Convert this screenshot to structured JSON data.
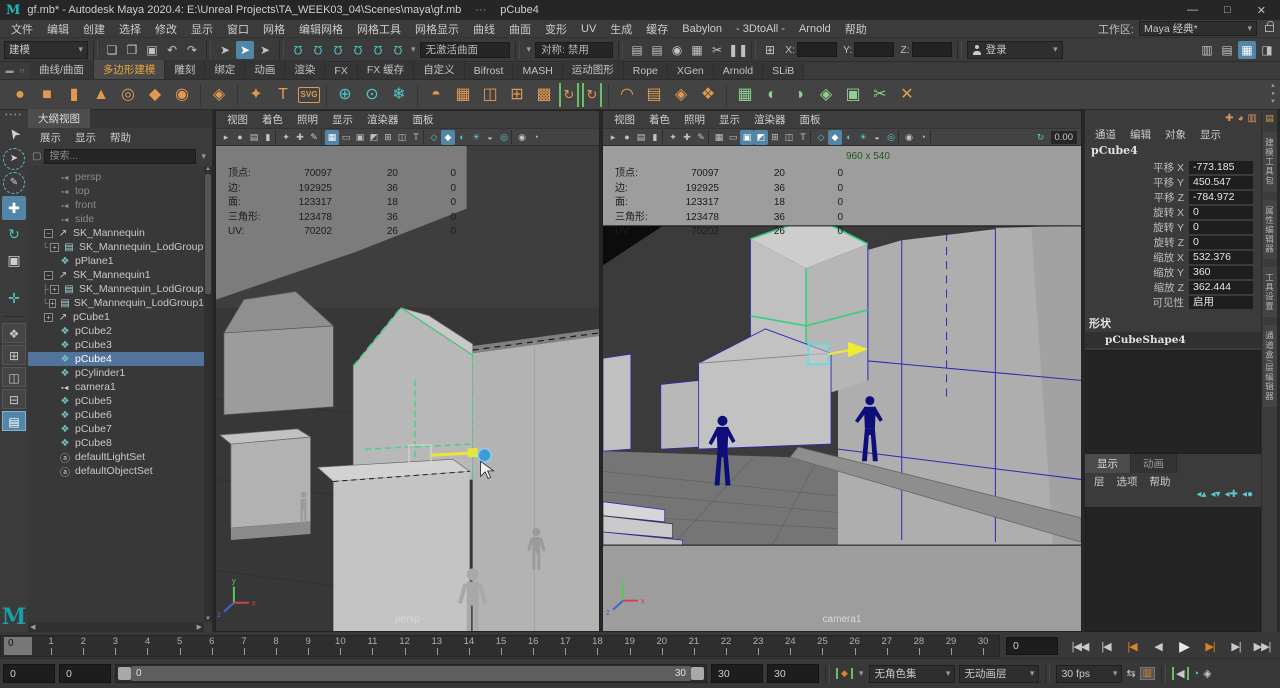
{
  "window": {
    "icon": "M",
    "title": "gf.mb* - Autodesk Maya 2020.4: E:\\Unreal Projects\\TA_WEEK03_04\\Scenes\\maya\\gf.mb",
    "dots": "···",
    "object": "pCube4",
    "minimize": "—",
    "maximize": "□",
    "close": "✕"
  },
  "menubar": {
    "items": [
      "文件",
      "编辑",
      "创建",
      "选择",
      "修改",
      "显示",
      "窗口",
      "网格",
      "编辑网格",
      "网格工具",
      "网格显示",
      "曲线",
      "曲面",
      "变形",
      "UV",
      "生成",
      "缓存",
      "Babylon",
      "- 3DtoAll -",
      "Arnold",
      "帮助"
    ],
    "workspace_label": "工作区:",
    "workspace_value": "Maya 经典*"
  },
  "statusline": {
    "mode": "建模",
    "file_icons": [
      {
        "n": "new-scene-icon",
        "g": "❏"
      },
      {
        "n": "open-scene-icon",
        "g": "❒"
      },
      {
        "n": "save-scene-icon",
        "g": "▣"
      },
      {
        "n": "undo-icon",
        "g": "↶"
      },
      {
        "n": "redo-icon",
        "g": "↷"
      }
    ],
    "select_icons": [
      {
        "n": "select-hierarchy-icon",
        "g": "➤"
      },
      {
        "n": "select-object-icon",
        "g": "➤",
        "a": true
      },
      {
        "n": "select-component-icon",
        "g": "➤"
      }
    ],
    "snap_icons": [
      {
        "n": "snap-to-grid-icon",
        "g": "Ω"
      },
      {
        "n": "snap-to-curve-icon",
        "g": "Ω"
      },
      {
        "n": "snap-to-point-icon",
        "g": "Ω"
      },
      {
        "n": "snap-to-projected-center-icon",
        "g": "Ω"
      },
      {
        "n": "snap-to-view-plane-icon",
        "g": "Ω"
      },
      {
        "n": "make-live-icon",
        "g": "Ω"
      }
    ],
    "no_active_surface": "无激活曲面",
    "symmetry": "对称: 禁用",
    "render_icons": [
      {
        "n": "render-view-icon",
        "g": "▤"
      },
      {
        "n": "render-current-frame-icon",
        "g": "▤"
      },
      {
        "n": "ipr-render-icon",
        "g": "◉",
        "t": true
      },
      {
        "n": "render-settings-icon",
        "g": "▦"
      },
      {
        "n": "render-sequence-icon",
        "g": "✂",
        "t": true
      },
      {
        "n": "pause-icon",
        "g": "❚❚"
      }
    ],
    "grid_toggle_glyph": "⊞",
    "x_label": "X:",
    "y_label": "Y:",
    "z_label": "Z:",
    "login_label": "登录",
    "right_icons": [
      {
        "n": "attribute-editor-toggle-icon",
        "g": "▥"
      },
      {
        "n": "tool-settings-toggle-icon",
        "g": "▤"
      },
      {
        "n": "channel-box-toggle-icon",
        "g": "▦",
        "a": true
      },
      {
        "n": "workspace-panel-icon",
        "g": "◨"
      }
    ]
  },
  "shelf": {
    "left_icons": [
      {
        "n": "shelf-tab-menu-icon",
        "g": "▬"
      },
      {
        "n": "shelf-menu-icon",
        "g": "○"
      }
    ],
    "tabs": [
      {
        "label": "曲线/曲面"
      },
      {
        "label": "多边形建模",
        "active": true
      },
      {
        "label": "雕刻"
      },
      {
        "label": "绑定"
      },
      {
        "label": "动画"
      },
      {
        "label": "渲染"
      },
      {
        "label": "FX"
      },
      {
        "label": "FX 缓存"
      },
      {
        "label": "自定义"
      },
      {
        "label": "Bifrost"
      },
      {
        "label": "MASH"
      },
      {
        "label": "运动图形"
      },
      {
        "label": "Rope"
      },
      {
        "label": "XGen"
      },
      {
        "label": "Arnold"
      },
      {
        "label": "SLiB"
      }
    ],
    "icons": [
      {
        "n": "poly-sphere-icon",
        "g": "●"
      },
      {
        "n": "poly-cube-icon",
        "g": "■"
      },
      {
        "n": "poly-cylinder-icon",
        "g": "▮"
      },
      {
        "n": "poly-cone-icon",
        "g": "▲"
      },
      {
        "n": "poly-torus-icon",
        "g": "◎"
      },
      {
        "n": "poly-plane-icon",
        "g": "◆"
      },
      {
        "n": "poly-disc-icon",
        "g": "◉"
      },
      {
        "sep": true
      },
      {
        "n": "platonic-solid-icon",
        "g": "◈"
      },
      {
        "sep": true
      },
      {
        "n": "curve-tool-icon",
        "g": "✦"
      },
      {
        "n": "type-tool-icon",
        "g": "T"
      },
      {
        "n": "svg-tool-icon",
        "g": "SVG",
        "sm": true
      },
      {
        "sep": true
      },
      {
        "n": "construction-plane-icon",
        "g": "⊕",
        "t": true
      },
      {
        "n": "time-node-icon",
        "g": "⊙",
        "t": true
      },
      {
        "n": "snap-origin-icon",
        "g": "❄",
        "t": true
      },
      {
        "sep": true
      },
      {
        "n": "boolean-icon",
        "g": "◓"
      },
      {
        "n": "combine-icon",
        "g": "▦"
      },
      {
        "n": "separate-icon",
        "g": "◫"
      },
      {
        "n": "smooth-icon",
        "g": "⊞"
      },
      {
        "n": "subdivide-icon",
        "g": "▩"
      },
      {
        "n": "quick-rig-icon",
        "g": "↻",
        "b": true
      },
      {
        "n": "auto-rig-icon",
        "g": "↻",
        "b": true
      },
      {
        "sep": true
      },
      {
        "n": "bend-deformer-icon",
        "g": "◠"
      },
      {
        "n": "lattice-icon",
        "g": "▤"
      },
      {
        "n": "wrap-deformer-icon",
        "g": "◈"
      },
      {
        "n": "cluster-icon",
        "g": "❖"
      },
      {
        "sep": true
      },
      {
        "n": "uv-planar-map-icon",
        "g": "▦",
        "gr": true
      },
      {
        "n": "uv-cylindrical-map-icon",
        "g": "◐",
        "gr": true
      },
      {
        "n": "uv-spherical-map-icon",
        "g": "◑",
        "gr": true
      },
      {
        "n": "uv-automatic-map-icon",
        "g": "◈",
        "gr": true
      },
      {
        "n": "uv-editor-icon",
        "g": "▣",
        "gr": true
      },
      {
        "n": "uv-cut-sew-icon",
        "g": "✂",
        "gr": true
      },
      {
        "n": "uv-delete-icon",
        "g": "✕"
      }
    ]
  },
  "toolbox": {
    "tools": [
      {
        "n": "select-tool",
        "g": "➤",
        "rot": true
      },
      {
        "n": "lasso-select-tool",
        "g": "➤",
        "circ": true
      },
      {
        "n": "paint-select-tool",
        "g": "✎",
        "circ": true
      },
      {
        "n": "move-tool",
        "g": "✚",
        "a": true
      },
      {
        "n": "rotate-tool",
        "g": "↻",
        "t": true
      },
      {
        "n": "scale-tool",
        "g": "▣"
      }
    ],
    "extra_tool": {
      "n": "universal-manipulator-icon",
      "g": "✛"
    },
    "layouts": [
      {
        "n": "layout-single-pane-button",
        "g": "❖"
      },
      {
        "n": "layout-four-pane-button",
        "g": "⊞"
      },
      {
        "n": "layout-two-pane-side-button",
        "g": "◫"
      },
      {
        "n": "layout-two-pane-stacked-button",
        "g": "⊟"
      },
      {
        "n": "layout-outliner-persp-button",
        "g": "▤",
        "a": true
      }
    ],
    "logo": "M"
  },
  "outliner": {
    "title": "大纲视图",
    "menus": [
      "展示",
      "显示",
      "帮助"
    ],
    "search_placeholder": "搜索...",
    "items": [
      {
        "label": "persp",
        "icon": "camera",
        "dim": true,
        "pad": "16px"
      },
      {
        "label": "top",
        "icon": "camera",
        "dim": true,
        "pad": "16px"
      },
      {
        "label": "front",
        "icon": "camera",
        "dim": true,
        "pad": "16px"
      },
      {
        "label": "side",
        "icon": "camera",
        "dim": true,
        "pad": "16px"
      },
      {
        "label": "SK_Mannequin",
        "icon": "transform",
        "expand": "−",
        "pad": "2px"
      },
      {
        "label": "SK_Mannequin_LodGroup",
        "icon": "lod",
        "expand": "+",
        "tree": "└",
        "pad": "8px"
      },
      {
        "label": "pPlane1",
        "icon": "mesh",
        "pad": "16px"
      },
      {
        "label": "SK_Mannequin1",
        "icon": "transform",
        "expand": "−",
        "pad": "2px"
      },
      {
        "label": "SK_Mannequin_LodGroup",
        "icon": "lod",
        "expand": "+",
        "tree": "├",
        "pad": "8px"
      },
      {
        "label": "SK_Mannequin_LodGroup1",
        "icon": "lod",
        "expand": "+",
        "tree": "└",
        "pad": "8px"
      },
      {
        "label": "pCube1",
        "icon": "transform",
        "expand": "+",
        "pad": "2px"
      },
      {
        "label": "pCube2",
        "icon": "mesh",
        "pad": "16px"
      },
      {
        "label": "pCube3",
        "icon": "mesh",
        "pad": "16px"
      },
      {
        "label": "pCube4",
        "icon": "mesh",
        "pad": "16px",
        "selected": true
      },
      {
        "label": "pCylinder1",
        "icon": "mesh",
        "pad": "16px"
      },
      {
        "label": "camera1",
        "icon": "camera",
        "pad": "16px"
      },
      {
        "label": "pCube5",
        "icon": "mesh",
        "pad": "16px"
      },
      {
        "label": "pCube6",
        "icon": "mesh",
        "pad": "16px"
      },
      {
        "label": "pCube7",
        "icon": "mesh",
        "pad": "16px"
      },
      {
        "label": "pCube8",
        "icon": "mesh",
        "pad": "16px"
      },
      {
        "label": "defaultLightSet",
        "icon": "set",
        "pad": "16px"
      },
      {
        "label": "defaultObjectSet",
        "icon": "set",
        "pad": "16px"
      }
    ]
  },
  "viewport_menus": [
    "视图",
    "着色",
    "照明",
    "显示",
    "渲染器",
    "面板"
  ],
  "hud_rows": [
    {
      "label": "顶点:",
      "v1": "70097",
      "v2": "20",
      "v3": "0"
    },
    {
      "label": "边:",
      "v1": "192925",
      "v2": "36",
      "v3": "0"
    },
    {
      "label": "面:",
      "v1": "123317",
      "v2": "18",
      "v3": "0"
    },
    {
      "label": "三角形:",
      "v1": "123478",
      "v2": "36",
      "v3": "0"
    },
    {
      "label": "UV:",
      "v1": "70202",
      "v2": "26",
      "v3": "0"
    }
  ],
  "viewport_left": {
    "label": "persp",
    "icons": [
      {
        "n": "select-camera-icon",
        "g": "▸"
      },
      {
        "n": "lock-camera-icon",
        "g": "●"
      },
      {
        "n": "camera-attributes-icon",
        "g": "▤"
      },
      {
        "n": "bookmark-icon",
        "g": "▮"
      },
      {
        "sep": true
      },
      {
        "n": "image-plane-icon",
        "g": "✦"
      },
      {
        "n": "pan-zoom-icon",
        "g": "✚"
      },
      {
        "n": "grease-pencil-icon",
        "g": "✎"
      },
      {
        "sep": true
      },
      {
        "n": "grid-icon",
        "g": "▦",
        "a": true
      },
      {
        "n": "film-gate-icon",
        "g": "▭"
      },
      {
        "n": "resolution-gate-icon",
        "g": "▣"
      },
      {
        "n": "gate-mask-icon",
        "g": "◩"
      },
      {
        "n": "field-chart-icon",
        "g": "⊞"
      },
      {
        "n": "safe-action-icon",
        "g": "◫"
      },
      {
        "n": "safe-title-icon",
        "g": "T"
      },
      {
        "sep": true
      },
      {
        "n": "wireframe-icon",
        "g": "◇",
        "t": true
      },
      {
        "n": "shaded-icon",
        "g": "◆",
        "t": true,
        "a": true
      },
      {
        "n": "textured-icon",
        "g": "◐",
        "t": true
      },
      {
        "n": "lights-icon",
        "g": "☀",
        "t": true
      },
      {
        "n": "shadows-icon",
        "g": "◒"
      },
      {
        "n": "ao-icon",
        "g": "◎",
        "t": true
      },
      {
        "sep": true
      },
      {
        "n": "isolate-select-icon",
        "g": "◉"
      },
      {
        "n": "xray-icon",
        "g": "◔"
      }
    ]
  },
  "viewport_right": {
    "label": "camera1",
    "resolution": "960 x 540",
    "exposure_glyph": "↻",
    "exposure_value": "0.00",
    "icons": [
      {
        "n": "select-camera-icon",
        "g": "▸"
      },
      {
        "n": "lock-camera-icon",
        "g": "●"
      },
      {
        "n": "camera-attributes-icon",
        "g": "▤"
      },
      {
        "n": "bookmark-icon",
        "g": "▮"
      },
      {
        "sep": true
      },
      {
        "n": "image-plane-icon",
        "g": "✦"
      },
      {
        "n": "pan-zoom-icon",
        "g": "✚"
      },
      {
        "n": "grease-pencil-icon",
        "g": "✎"
      },
      {
        "sep": true
      },
      {
        "n": "grid-icon",
        "g": "▦"
      },
      {
        "n": "film-gate-icon",
        "g": "▭"
      },
      {
        "n": "resolution-gate-icon",
        "g": "▣",
        "a": true
      },
      {
        "n": "gate-mask-icon",
        "g": "◩",
        "a": true
      },
      {
        "n": "field-chart-icon",
        "g": "⊞"
      },
      {
        "n": "safe-action-icon",
        "g": "◫"
      },
      {
        "n": "safe-title-icon",
        "g": "T"
      },
      {
        "sep": true
      },
      {
        "n": "wireframe-icon",
        "g": "◇",
        "t": true
      },
      {
        "n": "shaded-icon",
        "g": "◆",
        "t": true,
        "a": true
      },
      {
        "n": "textured-icon",
        "g": "◐",
        "t": true
      },
      {
        "n": "lights-icon",
        "g": "☀",
        "t": true
      },
      {
        "n": "shadows-icon",
        "g": "◒"
      },
      {
        "n": "ao-icon",
        "g": "◎",
        "t": true
      },
      {
        "sep": true
      },
      {
        "n": "isolate-select-icon",
        "g": "◉"
      },
      {
        "n": "xray-icon",
        "g": "◔"
      },
      {
        "sep": true
      }
    ]
  },
  "axis": {
    "x": "x",
    "y": "y",
    "z": "z"
  },
  "channel_box": {
    "corner_icons": [
      {
        "n": "show-manipulators-icon",
        "g": "✚"
      },
      {
        "n": "speed-ramp-icon",
        "g": "◕"
      },
      {
        "n": "channel-sliders-icon",
        "g": "▥"
      }
    ],
    "menus": [
      "通道",
      "编辑",
      "对象",
      "显示"
    ],
    "object": "pCube4",
    "rows": [
      {
        "label": "平移 X",
        "value": "-773.185"
      },
      {
        "label": "平移 Y",
        "value": "450.547"
      },
      {
        "label": "平移 Z",
        "value": "-784.972"
      },
      {
        "label": "旋转 X",
        "value": "0"
      },
      {
        "label": "旋转 Y",
        "value": "0"
      },
      {
        "label": "旋转 Z",
        "value": "0"
      },
      {
        "label": "缩放 X",
        "value": "532.376"
      },
      {
        "label": "缩放 Y",
        "value": "360"
      },
      {
        "label": "缩放 Z",
        "value": "362.444"
      },
      {
        "label": "可见性",
        "value": "启用"
      }
    ],
    "shapes_label": "形状",
    "shape": "pCubeShape4"
  },
  "layer_editor": {
    "tabs": [
      {
        "label": "显示",
        "active": true
      },
      {
        "label": "动画"
      }
    ],
    "menus": [
      "层",
      "选项",
      "帮助"
    ],
    "icons": [
      {
        "n": "move-layer-up-icon",
        "g": "◂▴"
      },
      {
        "n": "move-layer-down-icon",
        "g": "◂▾"
      },
      {
        "n": "new-empty-layer-icon",
        "g": "◂✚"
      },
      {
        "n": "new-layer-from-selected-icon",
        "g": "◂●"
      }
    ]
  },
  "right_strip": {
    "top_icon": "▤",
    "tabs": [
      "建模工具包",
      "属性编辑器",
      "工具设置",
      "通道盒/层编辑器"
    ]
  },
  "timeline": {
    "current": "0",
    "ticks": [
      "1",
      "2",
      "3",
      "4",
      "5",
      "6",
      "7",
      "8",
      "9",
      "10",
      "11",
      "12",
      "13",
      "14",
      "15",
      "16",
      "17",
      "18",
      "19",
      "20",
      "21",
      "22",
      "23",
      "24",
      "25",
      "26",
      "27",
      "28",
      "29",
      "30"
    ],
    "frame_field": "0",
    "playback": [
      {
        "n": "go-to-start-button",
        "g": "|◀◀"
      },
      {
        "n": "step-back-frame-button",
        "g": "|◀"
      },
      {
        "n": "step-back-key-button",
        "g": "|◀",
        "accent": true
      },
      {
        "n": "play-backwards-button",
        "g": "◀"
      },
      {
        "n": "play-forward-button",
        "g": "▶",
        "big": true
      },
      {
        "n": "step-forward-key-button",
        "g": "▶|",
        "accent": true
      },
      {
        "n": "step-forward-frame-button",
        "g": "▶|"
      },
      {
        "n": "go-to-end-button",
        "g": "▶▶|"
      }
    ]
  },
  "range": {
    "anim_start": "0",
    "play_start": "0",
    "handle_start": "0",
    "handle_end": "30",
    "play_end": "30",
    "anim_end": "30",
    "autokey_glyph": "◆",
    "char_set": "无角色集",
    "anim_layer": "无动画层",
    "fps": "30 fps",
    "loop_glyph": "⇆",
    "graph_glyph": "▥",
    "sound_glyph": "◀",
    "clock_glyph": "◔",
    "prefs_glyph": "◈"
  }
}
